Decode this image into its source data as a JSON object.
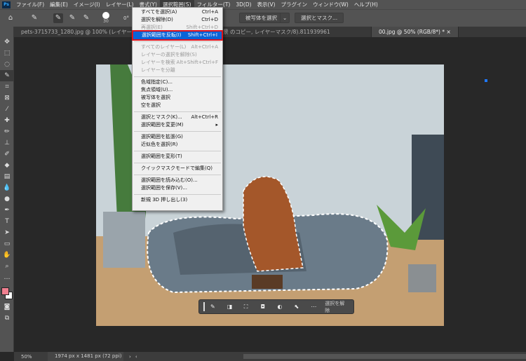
{
  "menubar": {
    "logo": "Ps",
    "items": [
      "ファイル(F)",
      "編集(E)",
      "イメージ(I)",
      "レイヤー(L)",
      "書式(Y)",
      "選択範囲(S)",
      "フィルター(T)",
      "3D(D)",
      "表示(V)",
      "プラグイン",
      "ウィンドウ(W)",
      "ヘルプ(H)"
    ]
  },
  "options": {
    "brush_size": "30",
    "angle": "0°",
    "select_subject": "被写体を選択",
    "select_mask": "選択とマスク..."
  },
  "tabs": [
    "pets-3715733_1280.jpg @ 100% (レイヤー 0, RGB/8) *",
    "811939961.jpg @ 50% (背景 のコピー, レイヤーマスク/8) *  ×",
    "00.jpg @ 50% (RGB/8*) *  ×"
  ],
  "menu": [
    {
      "label": "すべてを選択(A)",
      "shortcut": "Ctrl+A"
    },
    {
      "label": "選択を解除(D)",
      "shortcut": "Ctrl+D"
    },
    {
      "label": "再選択(E)",
      "shortcut": "Shift+Ctrl+D",
      "disabled": true
    },
    {
      "label": "選択範囲を反転(I)",
      "shortcut": "Shift+Ctrl+I",
      "highlight": true
    },
    {
      "sep": true
    },
    {
      "label": "すべてのレイヤー(L)",
      "shortcut": "Alt+Ctrl+A",
      "disabled": true
    },
    {
      "label": "レイヤーの選択を解除(S)",
      "shortcut": "",
      "disabled": true
    },
    {
      "label": "レイヤーを検索",
      "shortcut": "Alt+Shift+Ctrl+F",
      "disabled": true
    },
    {
      "label": "レイヤーを分離",
      "shortcut": "",
      "disabled": true
    },
    {
      "sep": true
    },
    {
      "label": "色域指定(C)...",
      "shortcut": ""
    },
    {
      "label": "焦点領域(U)...",
      "shortcut": ""
    },
    {
      "label": "被写体を選択",
      "shortcut": ""
    },
    {
      "label": "空を選択",
      "shortcut": ""
    },
    {
      "sep": true
    },
    {
      "label": "選択とマスク(K)...",
      "shortcut": "Alt+Ctrl+R"
    },
    {
      "label": "選択範囲を変更(M)",
      "shortcut": "▸"
    },
    {
      "sep": true
    },
    {
      "label": "選択範囲を拡張(G)",
      "shortcut": ""
    },
    {
      "label": "近似色を選択(R)",
      "shortcut": ""
    },
    {
      "sep": true
    },
    {
      "label": "選択範囲を変形(T)",
      "shortcut": ""
    },
    {
      "sep": true
    },
    {
      "label": "クイックマスクモードで編集(Q)",
      "shortcut": ""
    },
    {
      "sep": true
    },
    {
      "label": "選択範囲を読み込む(O)...",
      "shortcut": ""
    },
    {
      "label": "選択範囲を保存(V)...",
      "shortcut": ""
    },
    {
      "sep": true
    },
    {
      "label": "新規 3D 押し出し(3)",
      "shortcut": ""
    }
  ],
  "taskbar": {
    "deselect": "選択を解除"
  },
  "status": {
    "zoom": "50%",
    "doc_size": "1974 px x 1481 px (72 ppi)"
  },
  "colors": {
    "foreground": "#f08090",
    "background": "#ffffff",
    "highlight": "#0a64d8",
    "outline": "#e0141e"
  }
}
